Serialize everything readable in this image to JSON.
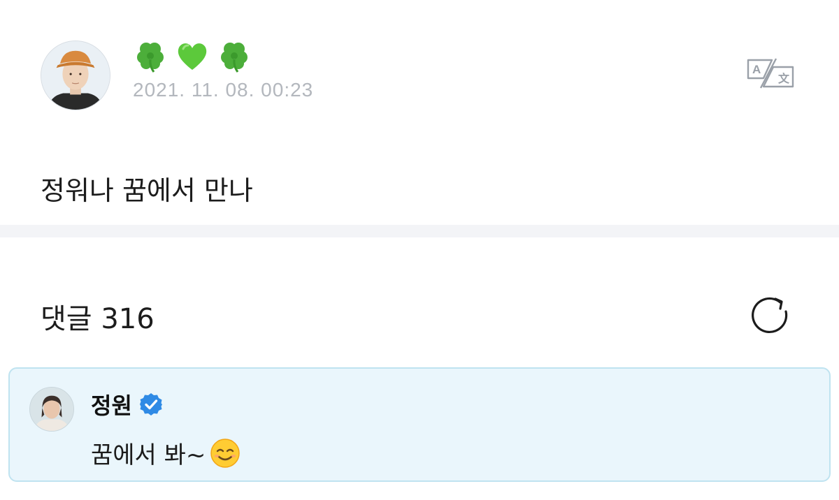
{
  "post": {
    "author": {
      "avatar_icon": "profile-photo-avatar",
      "name_emojis": [
        "four-leaf-clover-icon",
        "green-heart-icon",
        "four-leaf-clover-icon"
      ]
    },
    "timestamp": "2021. 11. 08. 00:23",
    "translate_icon": "translate-icon",
    "body": "정워나 꿈에서 만나"
  },
  "comments": {
    "title": "댓글 316",
    "refresh_icon": "refresh-icon",
    "pinned": {
      "author": "정원",
      "verified_icon": "verified-badge-icon",
      "text": "꿈에서 봐~",
      "emoji": "smiling-face-icon"
    }
  },
  "colors": {
    "timestamp": "#b3b7bd",
    "divider": "#f3f4f7",
    "card_bg": "#eaf6fc",
    "card_border": "#bfe3f0",
    "verified": "#2f8ae5",
    "clover": "#4cae3a",
    "heart": "#5cc93b"
  }
}
